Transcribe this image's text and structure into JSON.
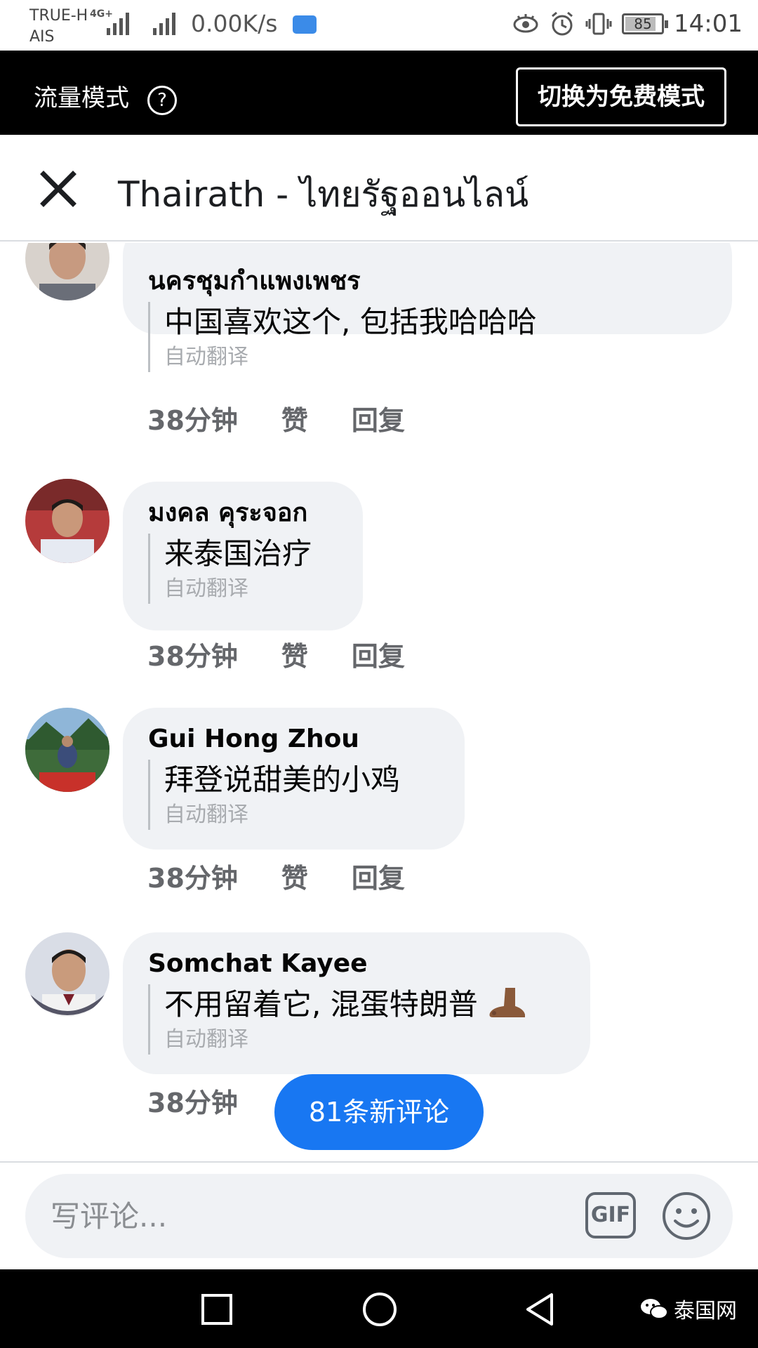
{
  "status_bar": {
    "carrier_1": "TRUE-H",
    "carrier_2": "AIS",
    "network": "4G+",
    "speed": "0.00K/s",
    "battery": "85",
    "time": "14:01"
  },
  "data_banner": {
    "mode_label": "流量模式",
    "help": "?",
    "switch_button": "切换为免费模式"
  },
  "header": {
    "title": "Thairath - ไทยรัฐออนไลน์"
  },
  "comments": [
    {
      "author": "นครชุมกำแพงเพชร",
      "text": "中国喜欢这个, 包括我哈哈哈",
      "translation_label": "自动翻译",
      "time": "38分钟",
      "like": "赞",
      "reply": "回复"
    },
    {
      "author": "มงคล คุระจอก",
      "text": "来泰国治疗",
      "translation_label": "自动翻译",
      "time": "38分钟",
      "like": "赞",
      "reply": "回复"
    },
    {
      "author": "Gui Hong Zhou",
      "text": "拜登说甜美的小鸡",
      "translation_label": "自动翻译",
      "time": "38分钟",
      "like": "赞",
      "reply": "回复"
    },
    {
      "author": "Somchat Kayee",
      "text": "不用留着它, 混蛋特朗普",
      "translation_label": "自动翻译",
      "time": "38分钟"
    }
  ],
  "new_comments_pill": "81条新评论",
  "composer": {
    "placeholder": "写评论...",
    "gif_label": "GIF"
  },
  "watermark": "泰国网",
  "colors": {
    "accent": "#1877f2",
    "bubble": "#f0f2f5",
    "meta_text": "#65676b"
  }
}
